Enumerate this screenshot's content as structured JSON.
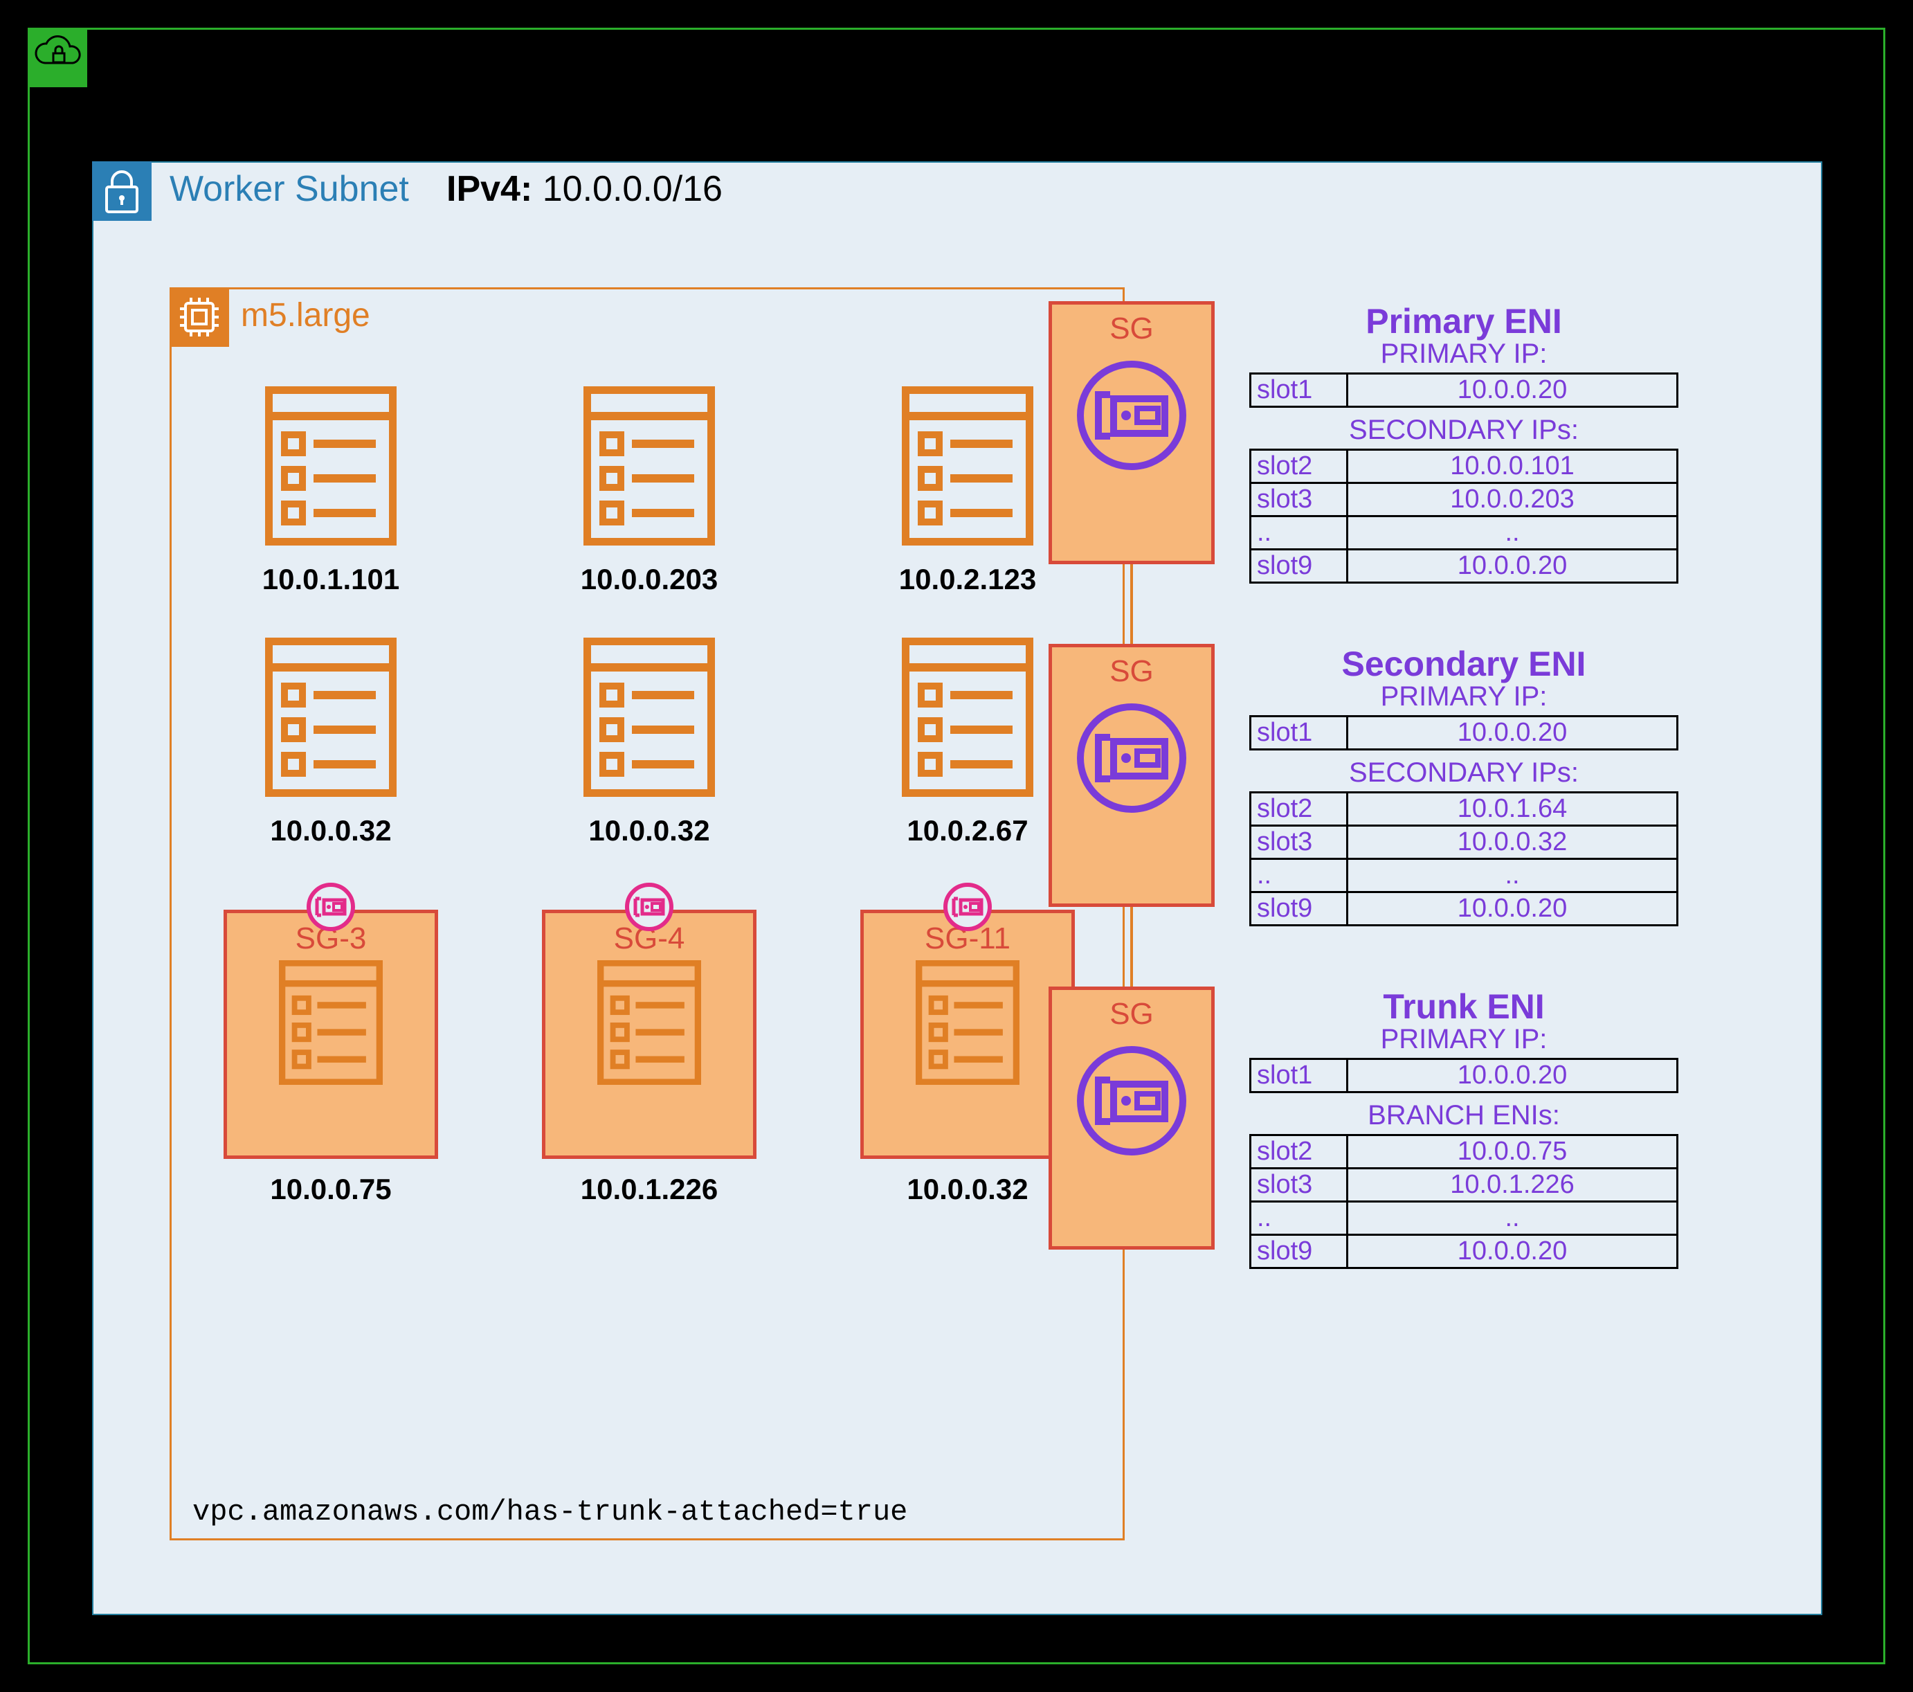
{
  "subnet": {
    "title": "Worker Subnet",
    "ipv4_label": "IPv4:",
    "ipv4_value": "10.0.0.0/16"
  },
  "instance": {
    "type": "m5.large",
    "trunk_footer": "vpc.amazonaws.com/has-trunk-attached=true"
  },
  "pods": {
    "row1": [
      {
        "ip": "10.0.1.101"
      },
      {
        "ip": "10.0.0.203"
      },
      {
        "ip": "10.0.2.123"
      }
    ],
    "row2": [
      {
        "ip": "10.0.0.32"
      },
      {
        "ip": "10.0.0.32"
      },
      {
        "ip": "10.0.2.67"
      }
    ],
    "row3": [
      {
        "sg": "SG-3",
        "ip": "10.0.0.75"
      },
      {
        "sg": "SG-4",
        "ip": "10.0.1.226"
      },
      {
        "sg": "SG-11",
        "ip": "10.0.0.32"
      }
    ]
  },
  "enis": [
    {
      "sg_label": "SG",
      "title": "Primary ENI",
      "primary_label": "PRIMARY IP:",
      "primary": {
        "slot": "slot1",
        "ip": "10.0.0.20"
      },
      "secondary_label": "SECONDARY IPs:",
      "secondary": [
        {
          "slot": "slot2",
          "ip": "10.0.0.101"
        },
        {
          "slot": "slot3",
          "ip": "10.0.0.203"
        },
        {
          "slot": "..",
          "ip": ".."
        },
        {
          "slot": "slot9",
          "ip": "10.0.0.20"
        }
      ]
    },
    {
      "sg_label": "SG",
      "title": "Secondary ENI",
      "primary_label": "PRIMARY IP:",
      "primary": {
        "slot": "slot1",
        "ip": "10.0.0.20"
      },
      "secondary_label": "SECONDARY IPs:",
      "secondary": [
        {
          "slot": "slot2",
          "ip": "10.0.1.64"
        },
        {
          "slot": "slot3",
          "ip": "10.0.0.32"
        },
        {
          "slot": "..",
          "ip": ".."
        },
        {
          "slot": "slot9",
          "ip": "10.0.0.20"
        }
      ]
    },
    {
      "sg_label": "SG",
      "title": "Trunk ENI",
      "primary_label": "PRIMARY IP:",
      "primary": {
        "slot": "slot1",
        "ip": "10.0.0.20"
      },
      "secondary_label": "BRANCH ENIs:",
      "secondary": [
        {
          "slot": "slot2",
          "ip": "10.0.0.75"
        },
        {
          "slot": "slot3",
          "ip": "10.0.1.226"
        },
        {
          "slot": "..",
          "ip": ".."
        },
        {
          "slot": "slot9",
          "ip": "10.0.0.20"
        }
      ]
    }
  ]
}
